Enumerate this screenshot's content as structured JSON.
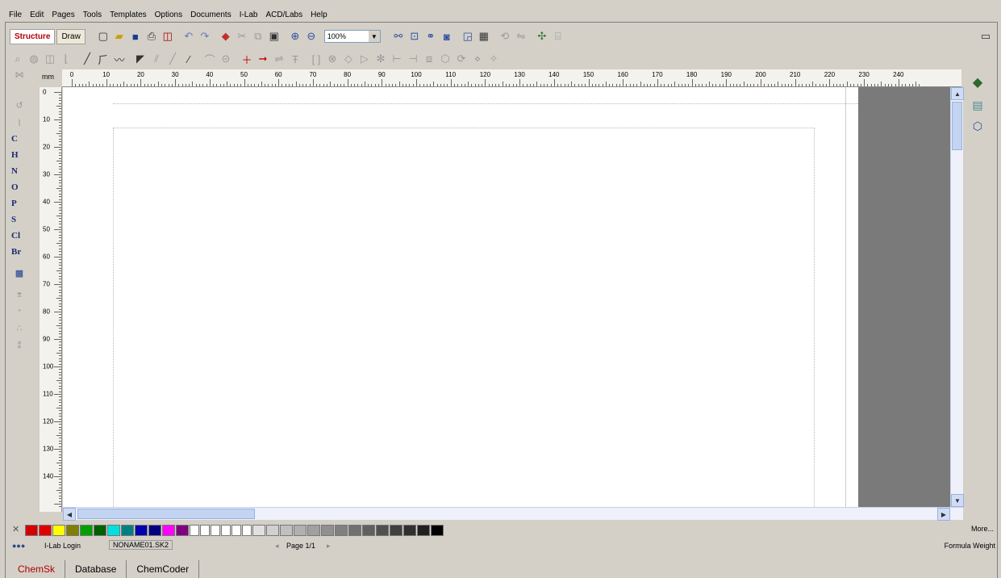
{
  "menu": [
    "File",
    "Edit",
    "Pages",
    "Tools",
    "Templates",
    "Options",
    "Documents",
    "I-Lab",
    "ACD/Labs",
    "Help"
  ],
  "mode_tabs": [
    "Structure",
    "Draw"
  ],
  "zoom": {
    "value": "100%"
  },
  "ruler": {
    "units": "mm",
    "h_labels": [
      "0",
      "10",
      "20",
      "30",
      "40",
      "50",
      "60",
      "70",
      "80",
      "90",
      "100",
      "110",
      "120",
      "130",
      "140",
      "150",
      "160",
      "170",
      "180",
      "190",
      "200",
      "210",
      "220",
      "230",
      "240"
    ],
    "v_labels": [
      "0",
      "10",
      "20",
      "30",
      "40",
      "50",
      "60",
      "70",
      "80",
      "90",
      "100",
      "110",
      "120",
      "130",
      "140"
    ]
  },
  "elements": [
    "C",
    "H",
    "N",
    "O",
    "P",
    "S",
    "Cl",
    "Br"
  ],
  "palette": {
    "colors": [
      "#d40000",
      "#e00000",
      "#ffff00",
      "#808000",
      "#00a000",
      "#006000",
      "#00e0e0",
      "#008080",
      "#0000b0",
      "#000080",
      "#ff00ff",
      "#800080",
      "#ffffff",
      "#ffffff",
      "#ffffff",
      "#ffffff",
      "#ffffff",
      "#ffffff",
      "#e0e0e0",
      "#d0d0d0",
      "#c0c0c0",
      "#b0b0b0",
      "#a0a0a0",
      "#909090",
      "#808080",
      "#707070",
      "#606060",
      "#505050",
      "#404040",
      "#303030",
      "#202020",
      "#000000"
    ],
    "more": "More..."
  },
  "status": {
    "login": "I-Lab Login",
    "file": "NONAME01.SK2",
    "page": "Page 1/1",
    "formula": "Formula Weight"
  },
  "bottom_tabs": [
    "ChemSk",
    "Database",
    "ChemCoder"
  ]
}
